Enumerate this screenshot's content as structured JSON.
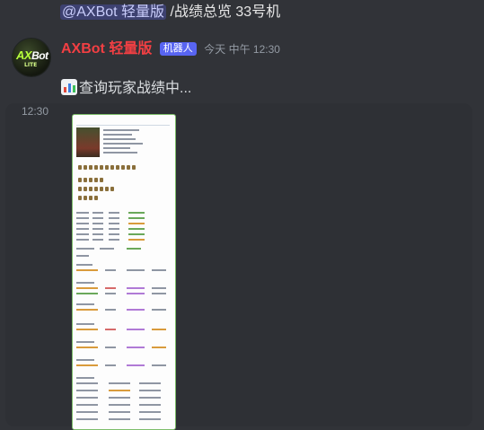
{
  "reply": {
    "mention": "@AXBot 轻量版",
    "command": "/战绩总览 33号机"
  },
  "message": {
    "username": "AXBot 轻量版",
    "bot_tag": "机器人",
    "timestamp": "今天 中午 12:30",
    "text": "查询玩家战绩中...",
    "emoji_name": "bar-chart-emoji"
  },
  "avatar": {
    "logo_main": "AX",
    "logo_sub": "Bot",
    "logo_small": "LITE"
  },
  "hover": {
    "time": "12:30"
  },
  "attachment": {
    "kind": "image",
    "description_title": "玩家 33号机 战绩总览"
  },
  "colors": {
    "background": "#313338",
    "username": "#f23f43",
    "bot_tag": "#5865f2",
    "mention": "#c9cdfb",
    "timestamp": "#949ba4",
    "attachment_border": "#7dbd6a"
  }
}
